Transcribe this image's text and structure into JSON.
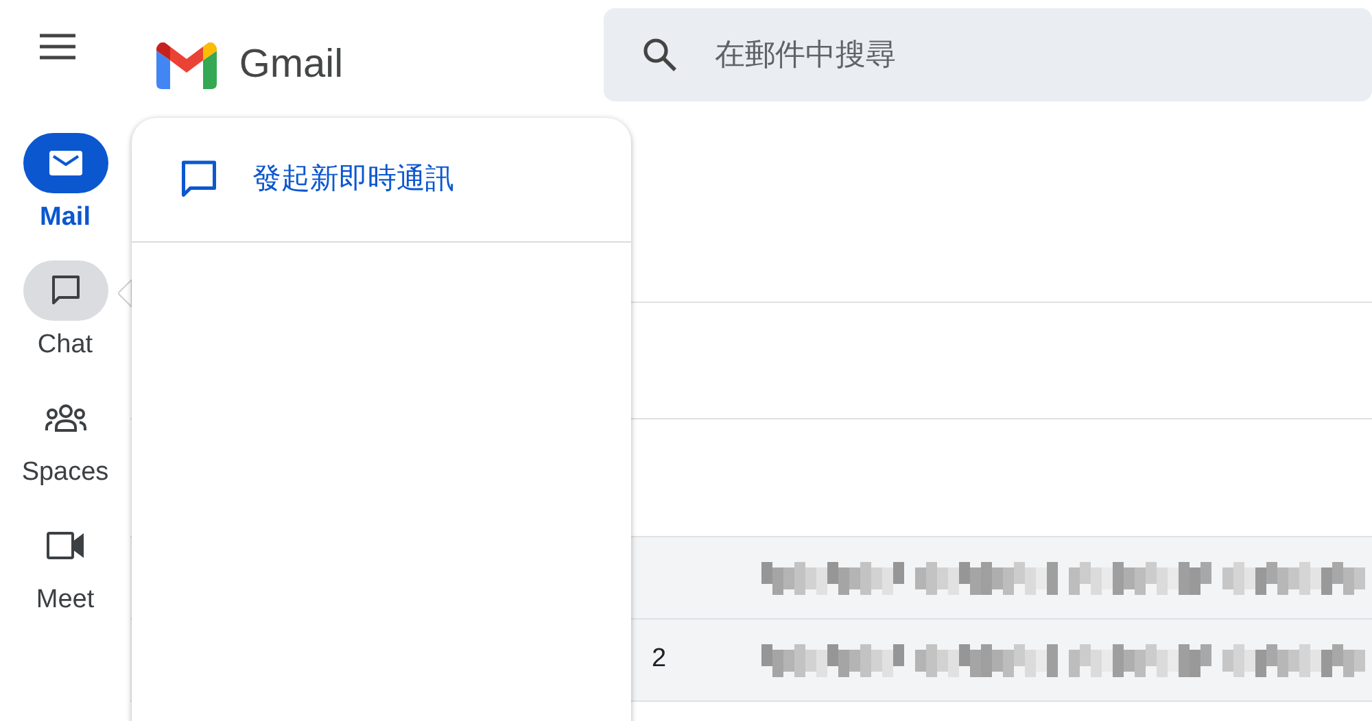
{
  "app": {
    "title": "Gmail"
  },
  "search": {
    "placeholder": "在郵件中搜尋"
  },
  "nav": [
    {
      "kind": "mail",
      "label": "Mail",
      "selected": true,
      "highlighted": false
    },
    {
      "kind": "chat",
      "label": "Chat",
      "selected": false,
      "highlighted": true
    },
    {
      "kind": "spaces",
      "label": "Spaces",
      "selected": false,
      "highlighted": false
    },
    {
      "kind": "meet",
      "label": "Meet",
      "selected": false,
      "highlighted": false
    }
  ],
  "popup": {
    "items": [
      {
        "label": "發起新即時通訊"
      }
    ]
  },
  "rows": [
    {
      "blurred": true
    },
    {
      "number": "2",
      "blurred": true
    }
  ]
}
